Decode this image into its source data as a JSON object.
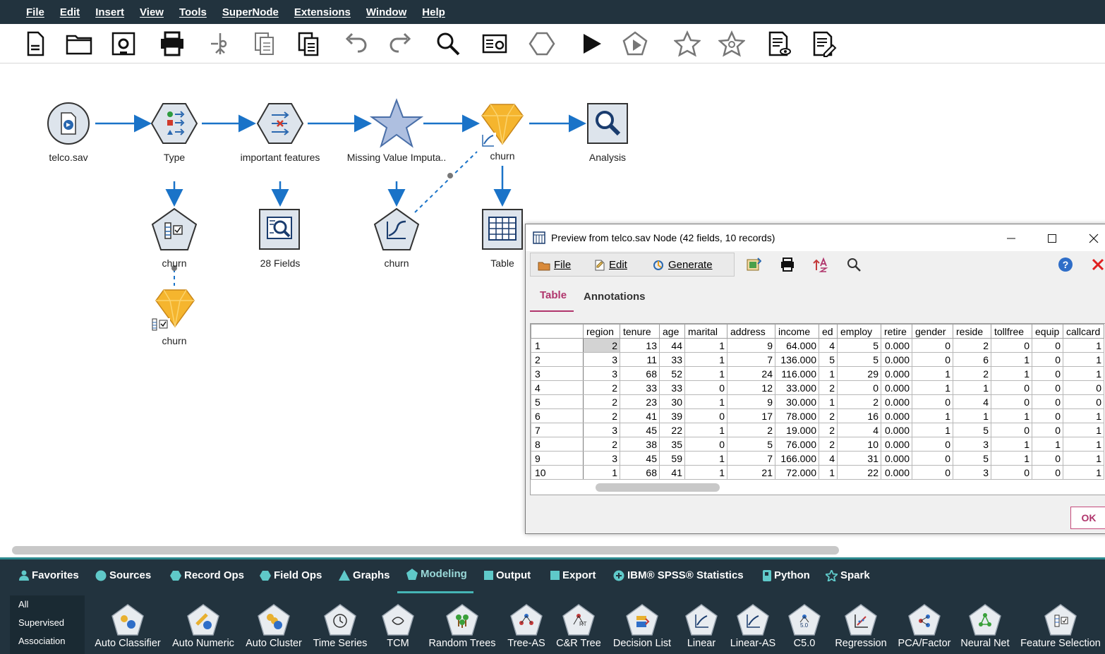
{
  "menubar": {
    "items": [
      "File",
      "Edit",
      "Insert",
      "View",
      "Tools",
      "SuperNode",
      "Extensions",
      "Window",
      "Help"
    ]
  },
  "toolbar": {
    "buttons": [
      "new-stream",
      "open-stream",
      "save-stream",
      "print",
      "cut",
      "copy",
      "paste",
      "undo",
      "redo",
      "find",
      "stream-properties",
      "supernode",
      "run",
      "run-selection",
      "add-favorite",
      "favorites",
      "preview",
      "edit-preview"
    ]
  },
  "canvas": {
    "nodes": {
      "telco": "telco.sav",
      "type": "Type",
      "important": "important features",
      "missing": "Missing Value Imputa..",
      "churn_model": "churn",
      "analysis": "Analysis",
      "churn_build": "churn",
      "fields28": "28 Fields",
      "churn_linear": "churn",
      "table": "Table",
      "churn_nugget": "churn"
    }
  },
  "palette": {
    "tabs": [
      "Favorites",
      "Sources",
      "Record Ops",
      "Field Ops",
      "Graphs",
      "Modeling",
      "Output",
      "Export",
      "IBM® SPSS® Statistics",
      "Python",
      "Spark"
    ],
    "active_tab": "Modeling",
    "subcategories": [
      "All",
      "Supervised",
      "Association"
    ],
    "nodes": [
      "Auto Classifier",
      "Auto Numeric",
      "Auto Cluster",
      "Time Series",
      "TCM",
      "Random Trees",
      "Tree-AS",
      "C&R Tree",
      "Decision List",
      "Linear",
      "Linear-AS",
      "C5.0",
      "Regression",
      "PCA/Factor",
      "Neural Net",
      "Feature Selection"
    ]
  },
  "dialog": {
    "title": "Preview from telco.sav Node (42 fields, 10 records)",
    "menu": {
      "file": "File",
      "edit": "Edit",
      "generate": "Generate"
    },
    "tabs": {
      "table": "Table",
      "annotations": "Annotations"
    },
    "table": {
      "columns": [
        "region",
        "tenure",
        "age",
        "marital",
        "address",
        "income",
        "ed",
        "employ",
        "retire",
        "gender",
        "reside",
        "tollfree",
        "equip",
        "callcard"
      ],
      "rows": [
        [
          "1",
          "2",
          "13",
          "44",
          "1",
          "9",
          "64.000",
          "4",
          "5",
          "0.000",
          "0",
          "2",
          "0",
          "0",
          "1"
        ],
        [
          "2",
          "3",
          "11",
          "33",
          "1",
          "7",
          "136.000",
          "5",
          "5",
          "0.000",
          "0",
          "6",
          "1",
          "0",
          "1"
        ],
        [
          "3",
          "3",
          "68",
          "52",
          "1",
          "24",
          "116.000",
          "1",
          "29",
          "0.000",
          "1",
          "2",
          "1",
          "0",
          "1"
        ],
        [
          "4",
          "2",
          "33",
          "33",
          "0",
          "12",
          "33.000",
          "2",
          "0",
          "0.000",
          "1",
          "1",
          "0",
          "0",
          "0"
        ],
        [
          "5",
          "2",
          "23",
          "30",
          "1",
          "9",
          "30.000",
          "1",
          "2",
          "0.000",
          "0",
          "4",
          "0",
          "0",
          "0"
        ],
        [
          "6",
          "2",
          "41",
          "39",
          "0",
          "17",
          "78.000",
          "2",
          "16",
          "0.000",
          "1",
          "1",
          "1",
          "0",
          "1"
        ],
        [
          "7",
          "3",
          "45",
          "22",
          "1",
          "2",
          "19.000",
          "2",
          "4",
          "0.000",
          "1",
          "5",
          "0",
          "0",
          "1"
        ],
        [
          "8",
          "2",
          "38",
          "35",
          "0",
          "5",
          "76.000",
          "2",
          "10",
          "0.000",
          "0",
          "3",
          "1",
          "1",
          "1"
        ],
        [
          "9",
          "3",
          "45",
          "59",
          "1",
          "7",
          "166.000",
          "4",
          "31",
          "0.000",
          "0",
          "5",
          "1",
          "0",
          "1"
        ],
        [
          "10",
          "1",
          "68",
          "41",
          "1",
          "21",
          "72.000",
          "1",
          "22",
          "0.000",
          "0",
          "3",
          "0",
          "0",
          "1"
        ]
      ]
    },
    "ok_label": "OK"
  },
  "colors": {
    "menubar_bg": "#22333e",
    "accent": "#b0356c",
    "flow_blue": "#1a73c8"
  }
}
